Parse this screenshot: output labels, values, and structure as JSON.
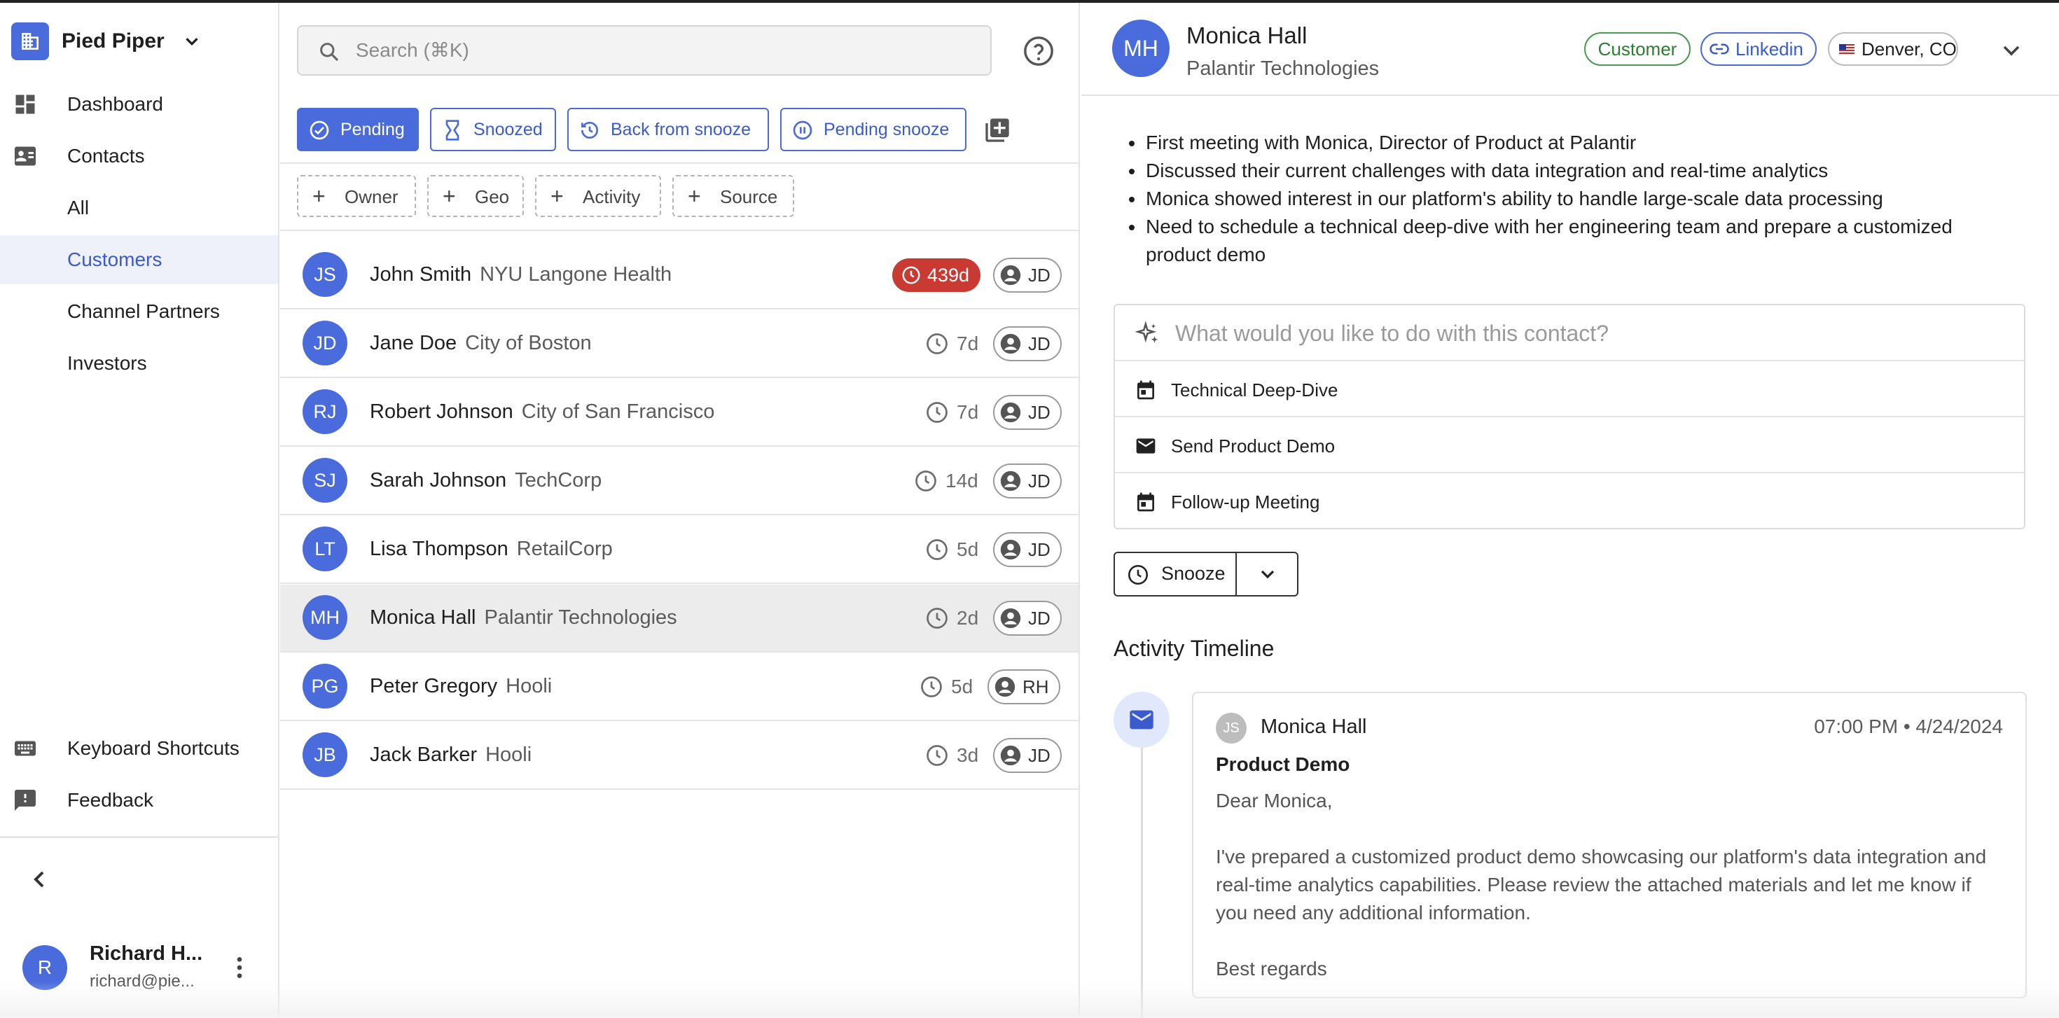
{
  "sidebar": {
    "workspace": "Pied Piper",
    "nav": [
      {
        "label": "Dashboard",
        "icon": "dashboard-icon"
      },
      {
        "label": "Contacts",
        "icon": "contacts-icon"
      },
      {
        "label": "All"
      },
      {
        "label": "Customers",
        "active": true
      },
      {
        "label": "Channel Partners"
      },
      {
        "label": "Investors"
      }
    ],
    "bottom": [
      {
        "label": "Keyboard Shortcuts",
        "icon": "keyboard-icon"
      },
      {
        "label": "Feedback",
        "icon": "feedback-icon"
      }
    ],
    "user": {
      "initial": "R",
      "name": "Richard H...",
      "email": "richard@pie..."
    }
  },
  "list": {
    "search_placeholder": "Search (⌘K)",
    "tabs": [
      {
        "label": "Pending",
        "active": true
      },
      {
        "label": "Snoozed"
      },
      {
        "label": "Back from snooze"
      },
      {
        "label": "Pending snooze"
      }
    ],
    "filters": [
      "Owner",
      "Geo",
      "Activity",
      "Source"
    ],
    "rows": [
      {
        "initials": "JS",
        "name": "John Smith",
        "org": "NYU Langone Health",
        "time": "439d",
        "overdue": true,
        "owner": "JD"
      },
      {
        "initials": "JD",
        "name": "Jane Doe",
        "org": "City of Boston",
        "time": "7d",
        "owner": "JD"
      },
      {
        "initials": "RJ",
        "name": "Robert Johnson",
        "org": "City of San Francisco",
        "time": "7d",
        "owner": "JD"
      },
      {
        "initials": "SJ",
        "name": "Sarah Johnson",
        "org": "TechCorp",
        "time": "14d",
        "owner": "JD"
      },
      {
        "initials": "LT",
        "name": "Lisa Thompson",
        "org": "RetailCorp",
        "time": "5d",
        "owner": "JD"
      },
      {
        "initials": "MH",
        "name": "Monica Hall",
        "org": "Palantir Technologies",
        "time": "2d",
        "owner": "JD",
        "selected": true
      },
      {
        "initials": "PG",
        "name": "Peter Gregory",
        "org": "Hooli",
        "time": "5d",
        "owner": "RH"
      },
      {
        "initials": "JB",
        "name": "Jack Barker",
        "org": "Hooli",
        "time": "3d",
        "owner": "JD"
      }
    ]
  },
  "detail": {
    "initials": "MH",
    "name": "Monica Hall",
    "org": "Palantir Technologies",
    "tag": "Customer",
    "linkedin": "Linkedin",
    "location": "Denver, CO",
    "notes": [
      "First meeting with Monica, Director of Product at Palantir",
      "Discussed their current challenges with data integration and real-time analytics",
      "Monica showed interest in our platform's ability to handle large-scale data processing",
      "Need to schedule a technical deep-dive with her engineering team and prepare a customized product demo"
    ],
    "ai_placeholder": "What would you like to do with this contact?",
    "actions": [
      {
        "label": "Technical Deep-Dive",
        "icon": "calendar-icon"
      },
      {
        "label": "Send Product Demo",
        "icon": "mail-icon"
      },
      {
        "label": "Follow-up Meeting",
        "icon": "calendar-icon"
      }
    ],
    "snooze_label": "Snooze",
    "timeline_title": "Activity Timeline",
    "timeline": {
      "avatar_initials": "JS",
      "from": "Monica Hall",
      "time": "07:00 PM • 4/24/2024",
      "subject": "Product Demo",
      "greeting": "Dear Monica,",
      "body": "I've prepared a customized product demo showcasing our platform's data integration and real-time analytics capabilities. Please review the attached materials and let me know if you need any additional information.",
      "signoff": "Best regards"
    }
  },
  "colors": {
    "accent": "#4a6bdc",
    "overdue": "#c83a32",
    "customer": "#2e7d32",
    "selected_row": "#ececec"
  }
}
